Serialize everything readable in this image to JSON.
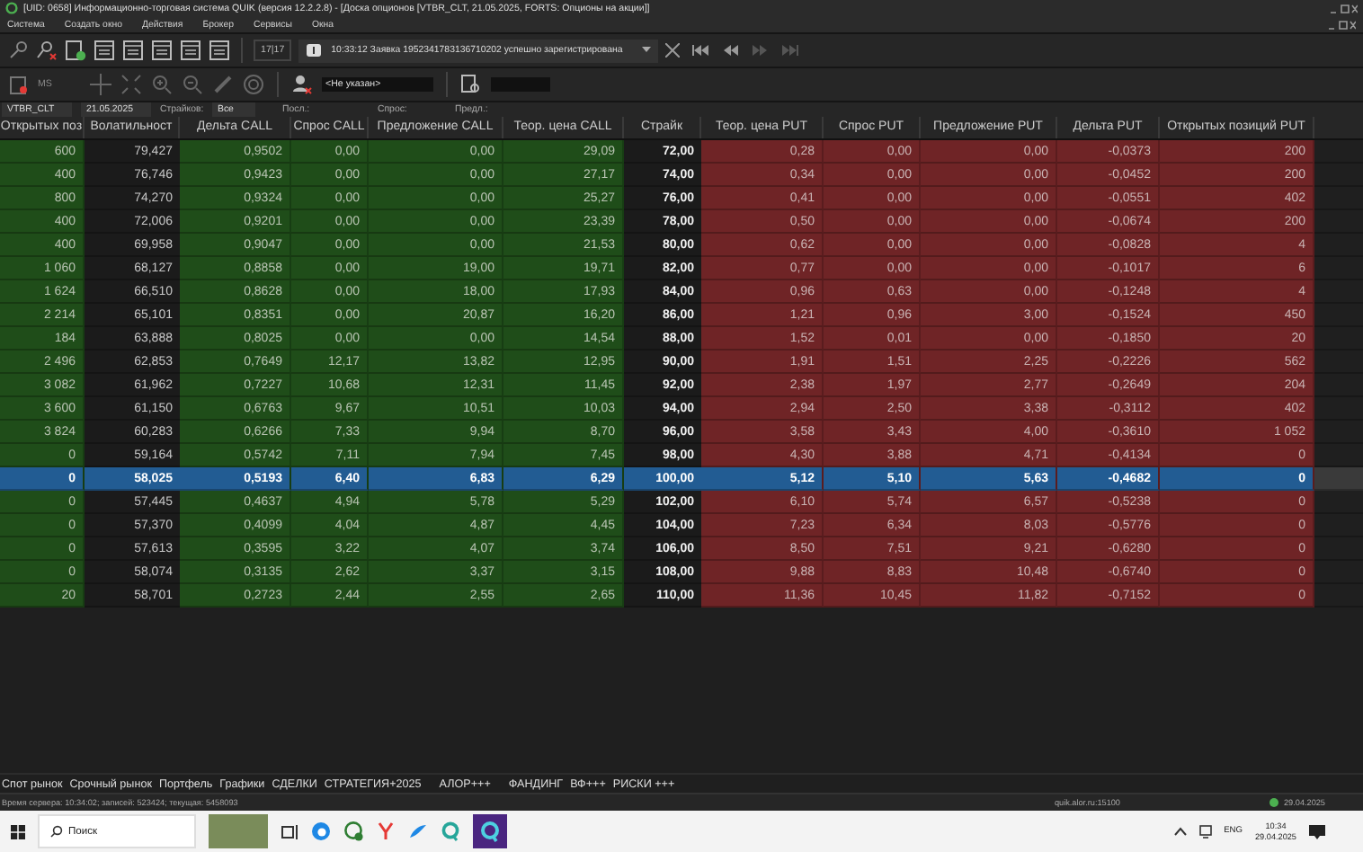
{
  "window": {
    "title": "[UID: 0658] Информационно-торговая система QUIK (версия 12.2.2.8) - [Доска опционов [VTBR_CLT, 21.05.2025, FORTS: Опционы на акции]]"
  },
  "menu": [
    "Система",
    "Создать окно",
    "Действия",
    "Брокер",
    "Сервисы",
    "Окна"
  ],
  "toolbar": {
    "counter": "17|17",
    "message": "10:33:12  Заявка 1952341783136710202 успешно зарегистрирована",
    "ms_label": "MS",
    "client": "<Не указан>"
  },
  "filters": {
    "instrument": "VTBR_CLT",
    "date": "21.05.2025",
    "strikes_label": "Страйков:",
    "strikes": "Все",
    "last_label": "Посл.:",
    "bid_label": "Спрос:",
    "ask_label": "Предл.:"
  },
  "table": {
    "columns": [
      {
        "label": "Открытых поз",
        "kind": "call"
      },
      {
        "label": "Волатильност",
        "kind": "vol"
      },
      {
        "label": "Дельта CALL",
        "kind": "call"
      },
      {
        "label": "Спрос CALL",
        "kind": "call"
      },
      {
        "label": "Предложение CALL",
        "kind": "call"
      },
      {
        "label": "Теор. цена CALL",
        "kind": "call"
      },
      {
        "label": "Страйк",
        "kind": "strike"
      },
      {
        "label": "Теор. цена PUT",
        "kind": "put"
      },
      {
        "label": "Спрос PUT",
        "kind": "put"
      },
      {
        "label": "Предложение PUT",
        "kind": "put"
      },
      {
        "label": "Дельта PUT",
        "kind": "put"
      },
      {
        "label": "Открытых позиций PUT",
        "kind": "put"
      }
    ],
    "rows": [
      {
        "selected": false,
        "cells": [
          "600",
          "79,427",
          "0,9502",
          "0,00",
          "0,00",
          "29,09",
          "72,00",
          "0,28",
          "0,00",
          "0,00",
          "-0,0373",
          "200"
        ]
      },
      {
        "selected": false,
        "cells": [
          "400",
          "76,746",
          "0,9423",
          "0,00",
          "0,00",
          "27,17",
          "74,00",
          "0,34",
          "0,00",
          "0,00",
          "-0,0452",
          "200"
        ]
      },
      {
        "selected": false,
        "cells": [
          "800",
          "74,270",
          "0,9324",
          "0,00",
          "0,00",
          "25,27",
          "76,00",
          "0,41",
          "0,00",
          "0,00",
          "-0,0551",
          "402"
        ]
      },
      {
        "selected": false,
        "cells": [
          "400",
          "72,006",
          "0,9201",
          "0,00",
          "0,00",
          "23,39",
          "78,00",
          "0,50",
          "0,00",
          "0,00",
          "-0,0674",
          "200"
        ]
      },
      {
        "selected": false,
        "cells": [
          "400",
          "69,958",
          "0,9047",
          "0,00",
          "0,00",
          "21,53",
          "80,00",
          "0,62",
          "0,00",
          "0,00",
          "-0,0828",
          "4"
        ]
      },
      {
        "selected": false,
        "cells": [
          "1 060",
          "68,127",
          "0,8858",
          "0,00",
          "19,00",
          "19,71",
          "82,00",
          "0,77",
          "0,00",
          "0,00",
          "-0,1017",
          "6"
        ]
      },
      {
        "selected": false,
        "cells": [
          "1 624",
          "66,510",
          "0,8628",
          "0,00",
          "18,00",
          "17,93",
          "84,00",
          "0,96",
          "0,63",
          "0,00",
          "-0,1248",
          "4"
        ]
      },
      {
        "selected": false,
        "cells": [
          "2 214",
          "65,101",
          "0,8351",
          "0,00",
          "20,87",
          "16,20",
          "86,00",
          "1,21",
          "0,96",
          "3,00",
          "-0,1524",
          "450"
        ]
      },
      {
        "selected": false,
        "cells": [
          "184",
          "63,888",
          "0,8025",
          "0,00",
          "0,00",
          "14,54",
          "88,00",
          "1,52",
          "0,01",
          "0,00",
          "-0,1850",
          "20"
        ]
      },
      {
        "selected": false,
        "cells": [
          "2 496",
          "62,853",
          "0,7649",
          "12,17",
          "13,82",
          "12,95",
          "90,00",
          "1,91",
          "1,51",
          "2,25",
          "-0,2226",
          "562"
        ]
      },
      {
        "selected": false,
        "cells": [
          "3 082",
          "61,962",
          "0,7227",
          "10,68",
          "12,31",
          "11,45",
          "92,00",
          "2,38",
          "1,97",
          "2,77",
          "-0,2649",
          "204"
        ]
      },
      {
        "selected": false,
        "cells": [
          "3 600",
          "61,150",
          "0,6763",
          "9,67",
          "10,51",
          "10,03",
          "94,00",
          "2,94",
          "2,50",
          "3,38",
          "-0,3112",
          "402"
        ]
      },
      {
        "selected": false,
        "cells": [
          "3 824",
          "60,283",
          "0,6266",
          "7,33",
          "9,94",
          "8,70",
          "96,00",
          "3,58",
          "3,43",
          "4,00",
          "-0,3610",
          "1 052"
        ]
      },
      {
        "selected": false,
        "cells": [
          "0",
          "59,164",
          "0,5742",
          "7,11",
          "7,94",
          "7,45",
          "98,00",
          "4,30",
          "3,88",
          "4,71",
          "-0,4134",
          "0"
        ]
      },
      {
        "selected": true,
        "cells": [
          "0",
          "58,025",
          "0,5193",
          "6,40",
          "6,83",
          "6,29",
          "100,00",
          "5,12",
          "5,10",
          "5,63",
          "-0,4682",
          "0"
        ]
      },
      {
        "selected": false,
        "cells": [
          "0",
          "57,445",
          "0,4637",
          "4,94",
          "5,78",
          "5,29",
          "102,00",
          "6,10",
          "5,74",
          "6,57",
          "-0,5238",
          "0"
        ]
      },
      {
        "selected": false,
        "cells": [
          "0",
          "57,370",
          "0,4099",
          "4,04",
          "4,87",
          "4,45",
          "104,00",
          "7,23",
          "6,34",
          "8,03",
          "-0,5776",
          "0"
        ]
      },
      {
        "selected": false,
        "cells": [
          "0",
          "57,613",
          "0,3595",
          "3,22",
          "4,07",
          "3,74",
          "106,00",
          "8,50",
          "7,51",
          "9,21",
          "-0,6280",
          "0"
        ]
      },
      {
        "selected": false,
        "cells": [
          "0",
          "58,074",
          "0,3135",
          "2,62",
          "3,37",
          "3,15",
          "108,00",
          "9,88",
          "8,83",
          "10,48",
          "-0,6740",
          "0"
        ]
      },
      {
        "selected": false,
        "cells": [
          "20",
          "58,701",
          "0,2723",
          "2,44",
          "2,55",
          "2,65",
          "110,00",
          "11,36",
          "10,45",
          "11,82",
          "-0,7152",
          "0"
        ]
      }
    ]
  },
  "tabs": [
    "Спот рынок",
    "Срочный рынок",
    "Портфель",
    "Графики",
    "СДЕЛКИ",
    "СТРАТЕГИЯ+2025",
    "АЛОР+++",
    "ФАНДИНГ",
    "ВФ+++",
    "РИСКИ +++"
  ],
  "status_bar": {
    "server": "Время сервера: 10:34:02; записей: 523424; текущая: 5458093",
    "host": "quik.alor.ru:15100",
    "date": "29.04.2025"
  },
  "taskbar": {
    "search": "Поиск",
    "language": "ENG",
    "time": "10:34",
    "date": "29.04.2025"
  }
}
